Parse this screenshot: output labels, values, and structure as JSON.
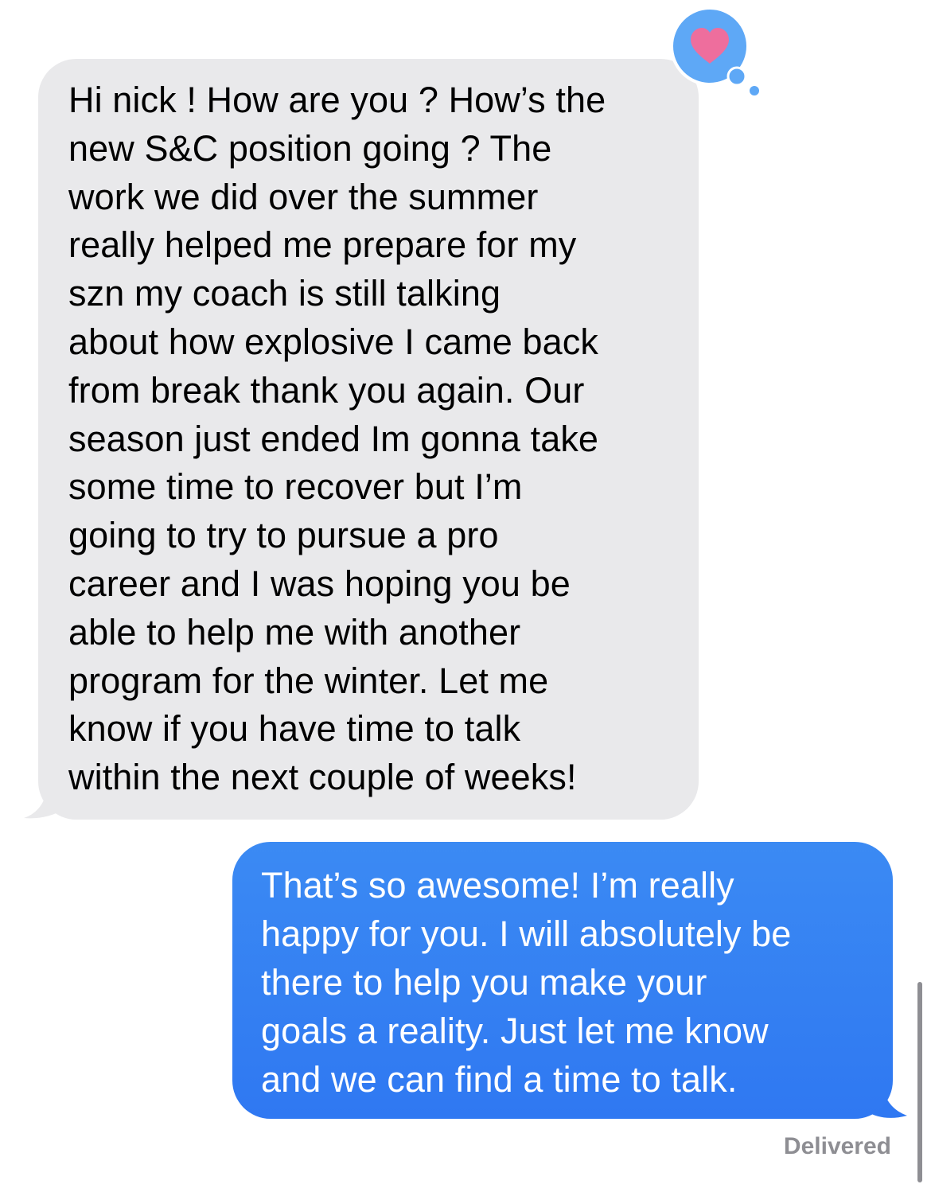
{
  "conversation": {
    "incoming_message": {
      "text": "Hi nick ! How are you ? How’s the\nnew S&C position going ? The\nwork we did over the summer\nreally helped me prepare for my\nszn my coach is still talking\nabout how explosive I came back\nfrom break thank you again. Our\nseason just ended Im gonna take\nsome time to recover but I’m\ngoing to try to pursue a pro\ncareer and I was hoping you be\nable to help me with another\nprogram for the winter. Let me\nknow if you have time to talk\nwithin the next couple of weeks!",
      "reaction_icon": "heart-icon"
    },
    "outgoing_message": {
      "text": "That’s so awesome! I’m really\nhappy for you. I will absolutely be\nthere to help you make your\ngoals a reality. Just let me know\nand we can find a time to talk."
    },
    "status": "Delivered"
  },
  "colors": {
    "incoming_bubble": "#e9e9eb",
    "outgoing_bubble": "#3281f2",
    "reaction_bubble": "#5ea8f6",
    "heart": "#ee6e9d",
    "status_text": "#8e8e93"
  }
}
